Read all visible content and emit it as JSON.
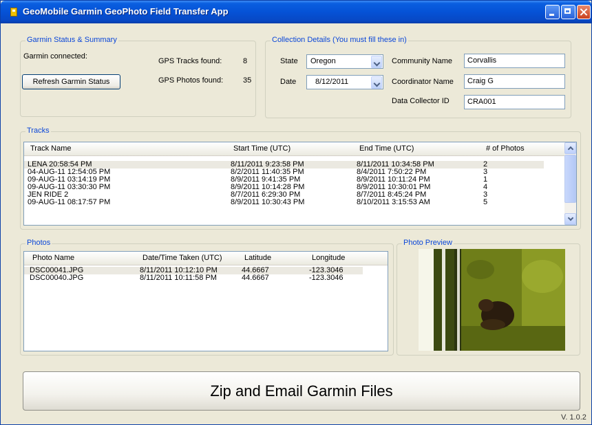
{
  "window": {
    "title": "GeoMobile Garmin GeoPhoto Field Transfer App",
    "version": "V. 1.0.2"
  },
  "garmin_status": {
    "group_title": "Garmin Status & Summary",
    "connection_text": "Garmin connected:",
    "refresh_button": "Refresh Garmin Status",
    "tracks_label": "GPS Tracks found:",
    "tracks_value": "8",
    "photos_label": "GPS Photos found:",
    "photos_value": "35"
  },
  "collection": {
    "group_title": "Collection Details  (You must fill these in)",
    "state_label": "State",
    "state_value": "Oregon",
    "date_label": "Date",
    "date_value": "8/12/2011",
    "community_label": "Community Name",
    "community_value": "Corvallis",
    "coordinator_label": "Coordinator Name",
    "coordinator_value": "Craig G",
    "collector_label": "Data Collector ID",
    "collector_value": "CRA001"
  },
  "tracks": {
    "group_title": "Tracks",
    "columns": [
      "Track Name",
      "Start Time (UTC)",
      "End Time (UTC)",
      "# of Photos"
    ],
    "rows": [
      [
        "LENA 20:58:54 PM",
        "8/11/2011 9:23:58 PM",
        "8/11/2011 10:34:58 PM",
        "2"
      ],
      [
        "04-AUG-11 12:54:05 PM",
        "8/2/2011 11:40:35 PM",
        "8/4/2011 7:50:22 PM",
        "3"
      ],
      [
        "09-AUG-11 03:14:19 PM",
        "8/9/2011 9:41:35 PM",
        "8/9/2011 10:11:24 PM",
        "1"
      ],
      [
        "09-AUG-11 03:30:30 PM",
        "8/9/2011 10:14:28 PM",
        "8/9/2011 10:30:01 PM",
        "4"
      ],
      [
        "JEN RIDE 2",
        "8/7/2011 6:29:30 PM",
        "8/7/2011 8:45:24 PM",
        "3"
      ],
      [
        "09-AUG-11 08:17:57 PM",
        "8/9/2011 10:30:43 PM",
        "8/10/2011 3:15:53 AM",
        "5"
      ]
    ]
  },
  "photos": {
    "group_title": "Photos",
    "columns": [
      "Photo Name",
      "Date/Time Taken (UTC)",
      "Latitude",
      "Longitude"
    ],
    "rows": [
      [
        "DSC00041.JPG",
        "8/11/2011 10:12:10 PM",
        "44.6667",
        "-123.3046"
      ],
      [
        "DSC00040.JPG",
        "8/11/2011 10:11:58 PM",
        "44.6667",
        "-123.3046"
      ]
    ]
  },
  "preview": {
    "group_title": "Photo Preview"
  },
  "actions": {
    "zip_email_button": "Zip and Email Garmin Files"
  },
  "colors": {
    "group_title": "#0a46d8",
    "titlebar": "#0552d6",
    "window_bg": "#ece9d8"
  },
  "icons": [
    "app-icon",
    "minimize-icon",
    "maximize-icon",
    "close-icon",
    "chevron-down-icon",
    "scroll-up-icon",
    "scroll-down-icon"
  ]
}
